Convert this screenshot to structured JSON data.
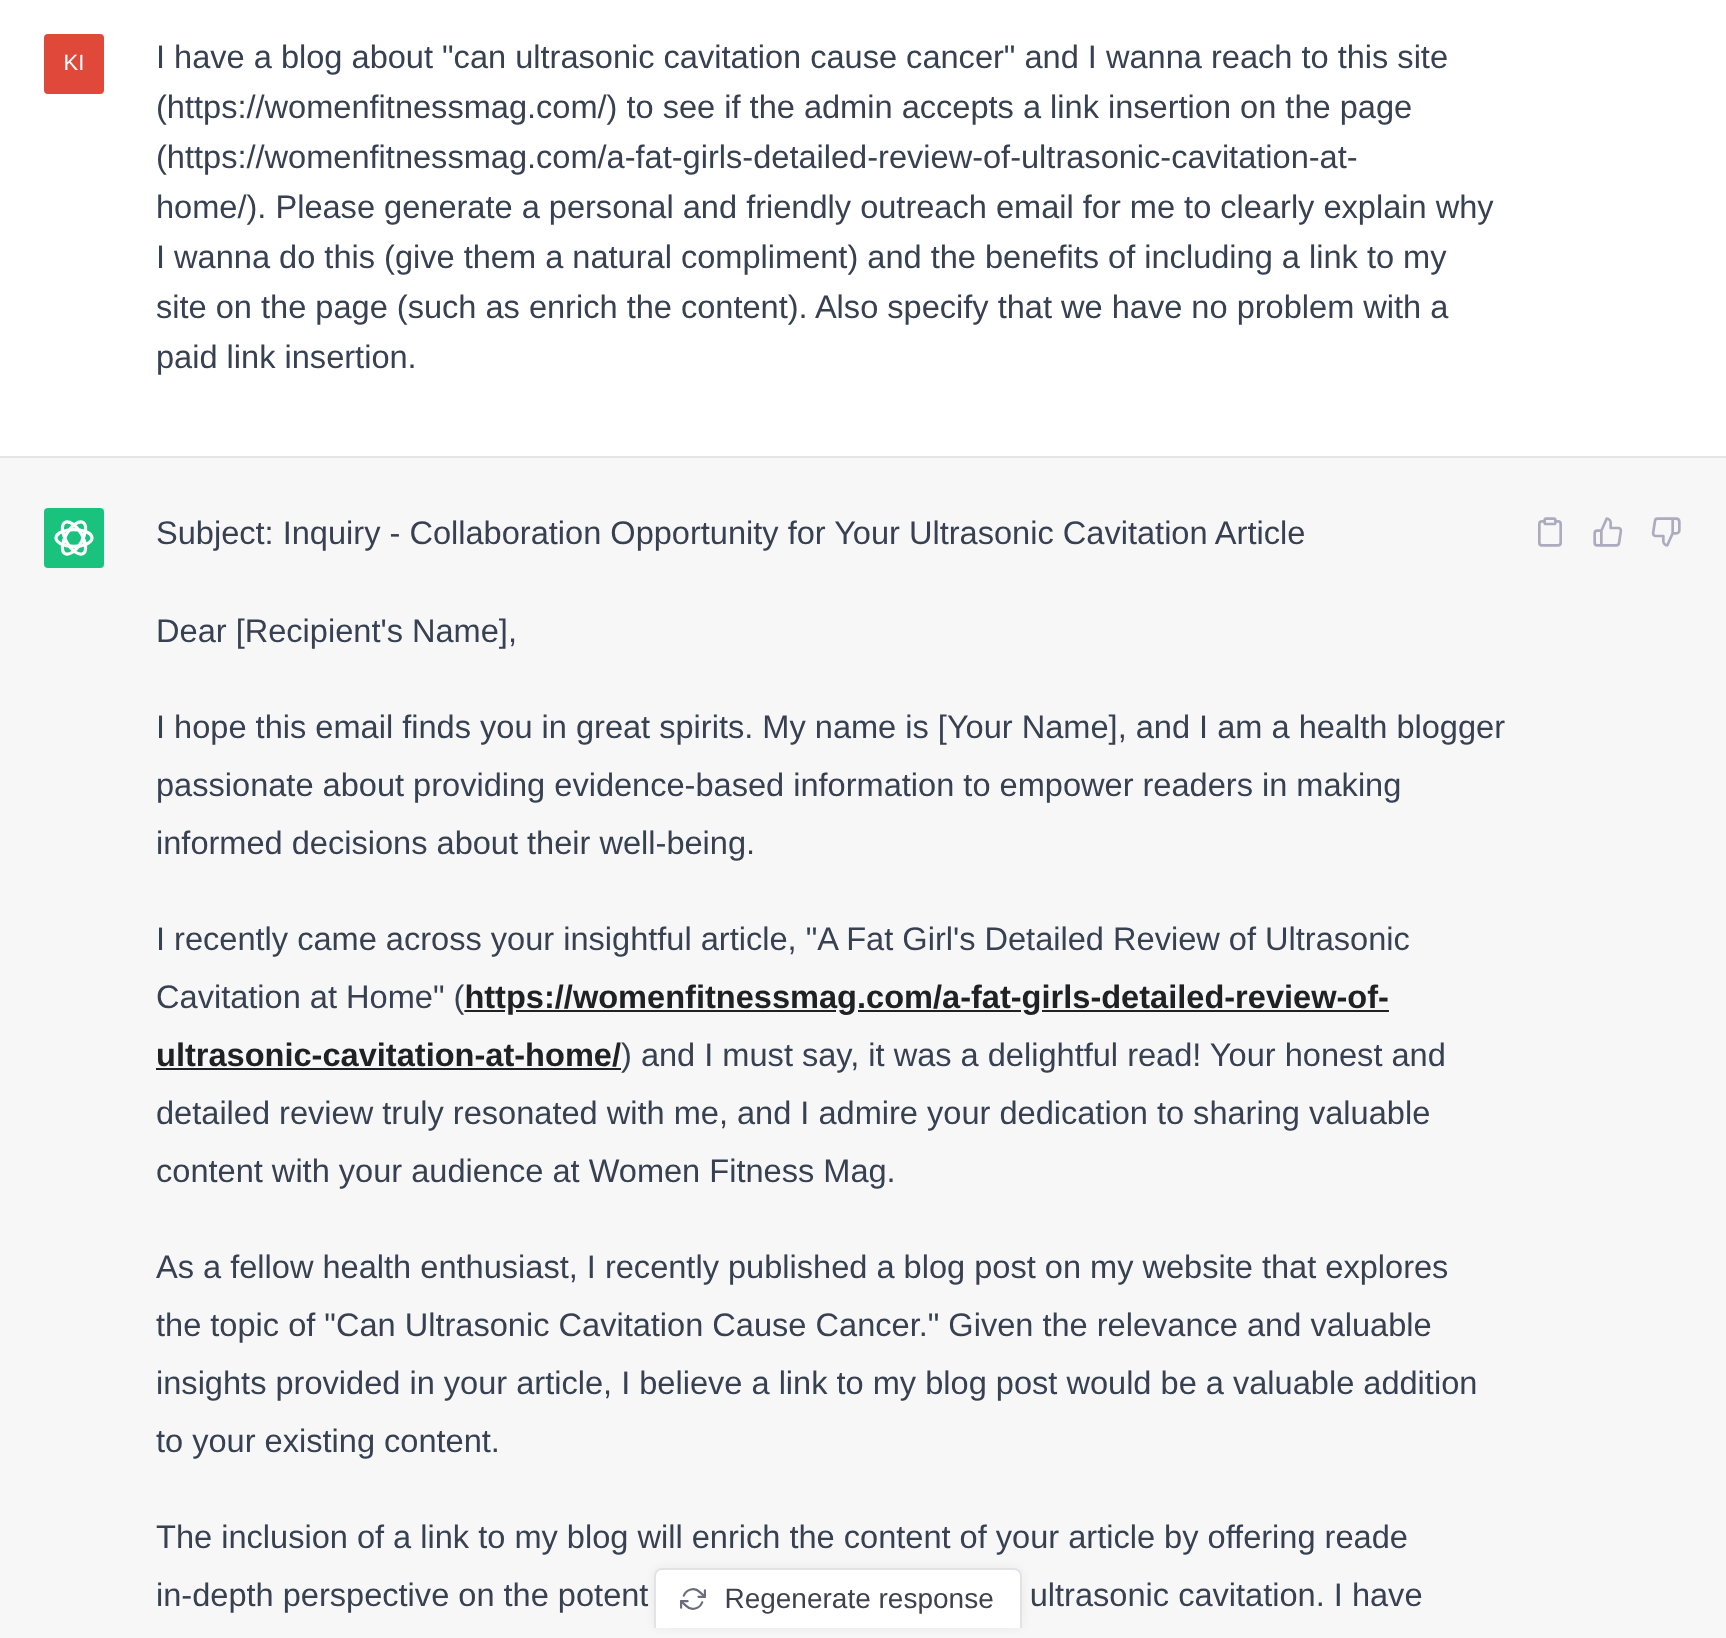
{
  "prompt": {
    "avatar": "KI",
    "lines": [
      "I have a blog about \"can ultrasonic cavitation cause cancer\" and I wanna reach to this site",
      "(https://womenfitnessmag.com/) to see if the admin accepts a link insertion on the page",
      "(https://womenfitnessmag.com/a-fat-girls-detailed-review-of-ultrasonic-cavitation-at-",
      "home/). Please generate a personal and friendly outreach email for me to clearly explain why",
      "I wanna do this (give them a natural compliment) and the benefits of including a link to my",
      "site on the page (such as enrich the content). Also specify that we have no problem with a",
      "paid link insertion."
    ]
  },
  "response": {
    "paragraphs": [
      {
        "lines": [
          "Subject: Inquiry - Collaboration Opportunity for Your Ultrasonic Cavitation Article"
        ]
      },
      {
        "lines": [
          "Dear [Recipient's Name],"
        ]
      },
      {
        "lines": [
          "I hope this email finds you in great spirits. My name is [Your Name], and I am a health blogger",
          "passionate about providing evidence-based information to empower readers in making",
          "informed decisions about their well-being."
        ]
      },
      {
        "lines": [
          "I recently came across your insightful article, \"A Fat Girl's Detailed Review of Ultrasonic",
          [
            {
              "kind": "text",
              "text": "Cavitation at Home\" ("
            },
            {
              "kind": "link",
              "text": "https://womenfitnessmag.com/a-fat-girls-detailed-review-of-"
            }
          ],
          [
            {
              "kind": "link",
              "text": "ultrasonic-cavitation-at-home/"
            },
            {
              "kind": "text",
              "text": ") and I must say, it was a delightful read! Your honest and"
            }
          ],
          "detailed review truly resonated with me, and I admire your dedication to sharing valuable",
          "content with your audience at Women Fitness Mag."
        ]
      },
      {
        "lines": [
          "As a fellow health enthusiast, I recently published a blog post on my website that explores",
          "the topic of \"Can Ultrasonic Cavitation Cause Cancer.\" Given the relevance and valuable",
          "insights provided in your article, I believe a link to my blog post would be a valuable addition",
          "to your existing content."
        ]
      },
      {
        "lines": [
          "The inclusion of a link to my blog will enrich the content of your article by offering reade",
          [
            {
              "kind": "text",
              "text": "in-depth perspective on the potent"
            },
            {
              "kind": "button",
              "text": "Regenerate response"
            },
            {
              "kind": "text",
              "text": "ultrasonic cavitation. I have"
            }
          ]
        ]
      }
    ]
  }
}
